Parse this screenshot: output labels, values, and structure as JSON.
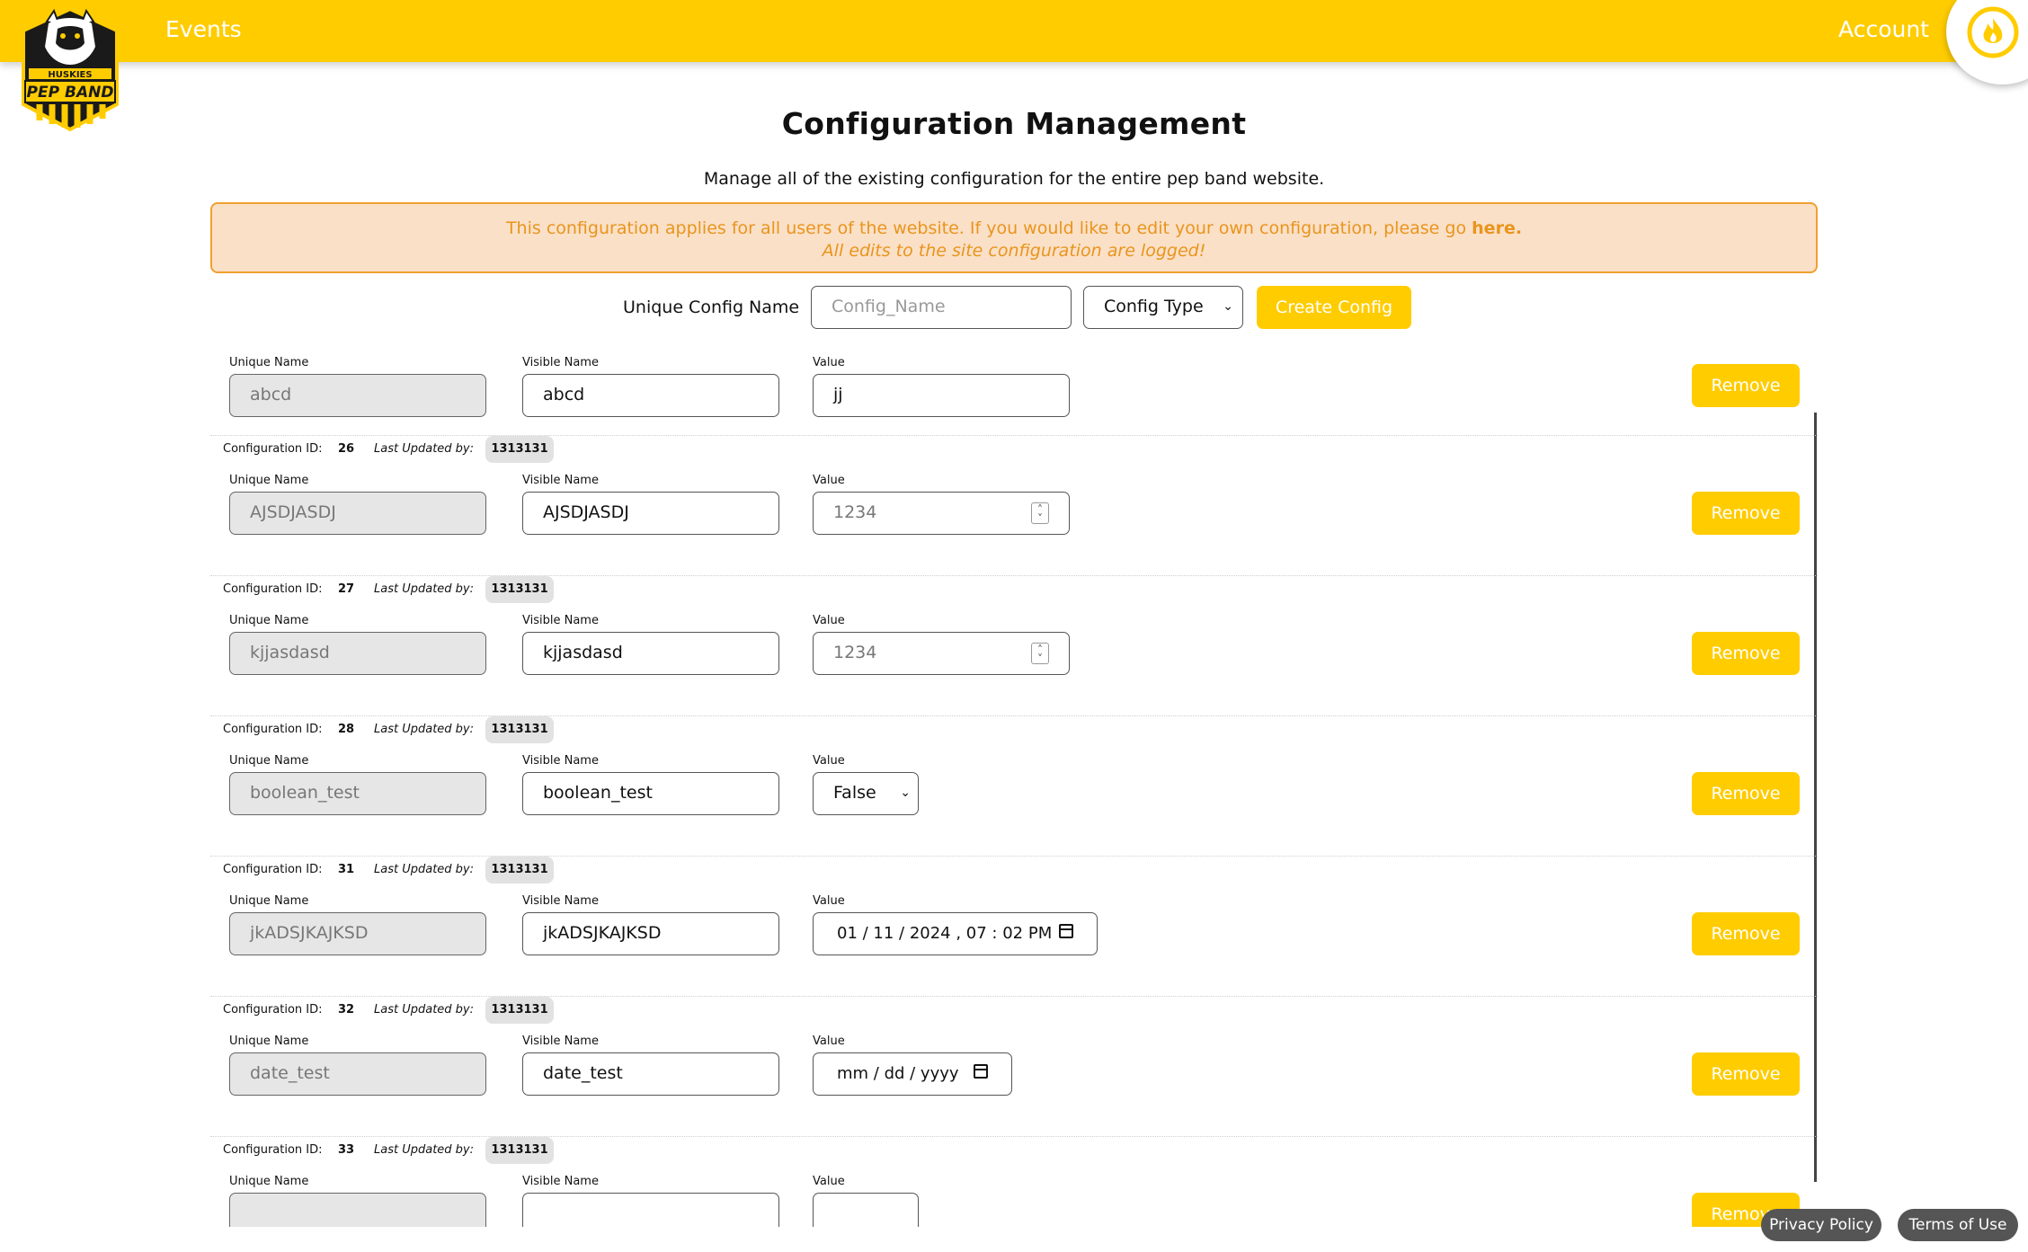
{
  "nav": {
    "events_label": "Events",
    "account_label": "Account",
    "logo_top": "HUSKIES",
    "logo_main": "PEP BAND"
  },
  "header": {
    "title": "Configuration Management",
    "subtitle": "Manage all of the existing configuration for the entire pep band website."
  },
  "notice": {
    "text": "This configuration applies for all users of the website. If you would like to edit your own configuration, please go",
    "link": "here.",
    "warning": "All edits to the site configuration are logged!"
  },
  "create": {
    "label": "Unique Config Name",
    "placeholder": "Config_Name",
    "type_select": "Config Type",
    "button": "Create Config"
  },
  "field_labels": {
    "unique": "Unique Name",
    "visible": "Visible Name",
    "value": "Value"
  },
  "meta_labels": {
    "config_id": "Configuration ID:",
    "updated_by": "Last Updated by:"
  },
  "remove_label": "Remove",
  "rows": [
    {
      "unique": "abcd",
      "visible": "abcd",
      "value": "jj"
    },
    {
      "id": "26",
      "updated_by": "1313131",
      "unique": "AJSDJASDJ",
      "visible": "AJSDJASDJ",
      "value": "1234"
    },
    {
      "id": "27",
      "updated_by": "1313131",
      "unique": "kjjasdasd",
      "visible": "kjjasdasd",
      "value": "1234"
    },
    {
      "id": "28",
      "updated_by": "1313131",
      "unique": "boolean_test",
      "visible": "boolean_test",
      "value": "False"
    },
    {
      "id": "31",
      "updated_by": "1313131",
      "unique": "jkADSJKAJKSD",
      "visible": "jkADSJKAJKSD",
      "value": "01 / 11 / 2024 ,  07 : 02  PM"
    },
    {
      "id": "32",
      "updated_by": "1313131",
      "unique": "date_test",
      "visible": "date_test",
      "value": "mm / dd / yyyy"
    },
    {
      "id": "33",
      "updated_by": "1313131"
    }
  ],
  "footer": {
    "privacy": "Privacy Policy",
    "terms": "Terms of Use"
  },
  "colors": {
    "accent": "#ffcc00",
    "notice_bg": "#fbe0c8",
    "notice_text": "#e8951c"
  }
}
